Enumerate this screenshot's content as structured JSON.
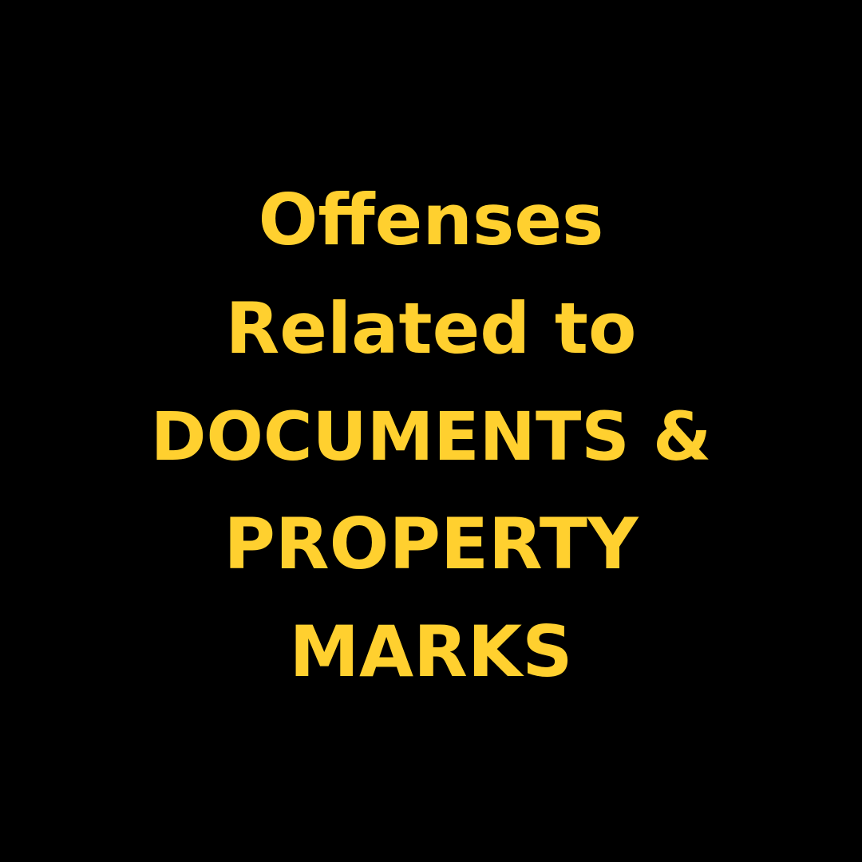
{
  "colors": {
    "background": "#000000",
    "text": "#FFD02F"
  },
  "title": {
    "lines": [
      "Offenses",
      "Related to",
      "DOCUMENTS &",
      "PROPERTY",
      "MARKS"
    ]
  }
}
